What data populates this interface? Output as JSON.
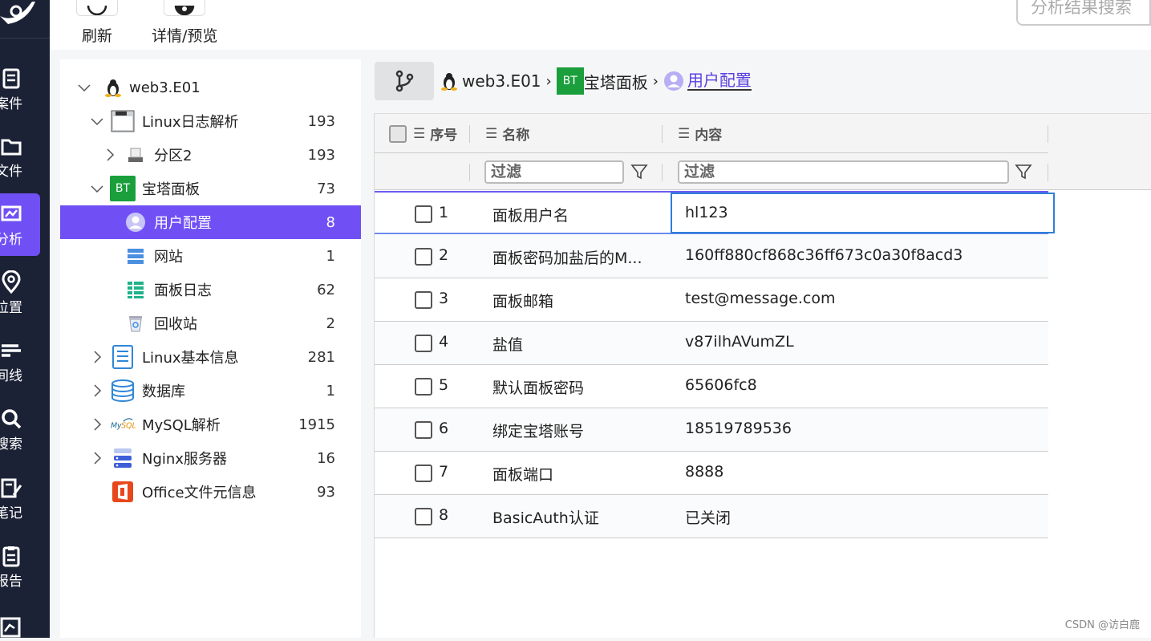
{
  "nav": {
    "items": [
      {
        "label": "案件",
        "icon": "case-icon"
      },
      {
        "label": "文件",
        "icon": "folder-icon"
      },
      {
        "label": "分析",
        "icon": "analysis-icon"
      },
      {
        "label": "位置",
        "icon": "location-icon"
      },
      {
        "label": "间线",
        "icon": "timeline-icon"
      },
      {
        "label": "搜索",
        "icon": "search-icon"
      },
      {
        "label": "笔记",
        "icon": "note-icon"
      },
      {
        "label": "报告",
        "icon": "report-icon"
      }
    ]
  },
  "toolbar": {
    "refresh_label": "刷新",
    "detail_label": "详情/预览",
    "search_placeholder": "分析结果搜索"
  },
  "tree": {
    "root": {
      "label": "web3.E01",
      "icon": "linux-penguin-icon"
    },
    "nodes": [
      {
        "label": "Linux日志解析",
        "count": "193",
        "icon": "log-icon"
      },
      {
        "label": "分区2",
        "count": "193",
        "icon": "disk-icon"
      },
      {
        "label": "宝塔面板",
        "count": "73",
        "icon": "bt-panel-icon"
      },
      {
        "label": "用户配置",
        "count": "8",
        "icon": "user-icon"
      },
      {
        "label": "网站",
        "count": "1",
        "icon": "server-icon"
      },
      {
        "label": "面板日志",
        "count": "62",
        "icon": "list-icon"
      },
      {
        "label": "回收站",
        "count": "2",
        "icon": "recycle-bin-icon"
      },
      {
        "label": "Linux基本信息",
        "count": "281",
        "icon": "info-icon"
      },
      {
        "label": "数据库",
        "count": "1",
        "icon": "database-icon"
      },
      {
        "label": "MySQL解析",
        "count": "1915",
        "icon": "mysql-icon"
      },
      {
        "label": "Nginx服务器",
        "count": "16",
        "icon": "nginx-icon"
      },
      {
        "label": "Office文件元信息",
        "count": "93",
        "icon": "office-icon"
      }
    ]
  },
  "breadcrumb": {
    "root": "web3.E01",
    "middle": "宝塔面板",
    "bt_logo": "BT",
    "current": "用户配置"
  },
  "grid": {
    "headers": {
      "index": "序号",
      "name": "名称",
      "content": "内容"
    },
    "filter_placeholder": "过滤",
    "rows": [
      {
        "num": "1",
        "name": "面板用户名",
        "value": "hl123"
      },
      {
        "num": "2",
        "name": "面板密码加盐后的M...",
        "value": "160ff880cf868c36ff673c0a30f8acd3"
      },
      {
        "num": "3",
        "name": "面板邮箱",
        "value": "test@message.com"
      },
      {
        "num": "4",
        "name": "盐值",
        "value": "v87ilhAVumZL"
      },
      {
        "num": "5",
        "name": "默认面板密码",
        "value": "65606fc8"
      },
      {
        "num": "6",
        "name": "绑定宝塔账号",
        "value": "18519789536"
      },
      {
        "num": "7",
        "name": "面板端口",
        "value": "8888"
      },
      {
        "num": "8",
        "name": "BasicAuth认证",
        "value": "已关闭"
      }
    ]
  },
  "watermark": "CSDN @访白鹿",
  "colors": {
    "accent": "#7050f5",
    "nav_bg": "#1c2236",
    "focus": "#2f7fd8"
  }
}
